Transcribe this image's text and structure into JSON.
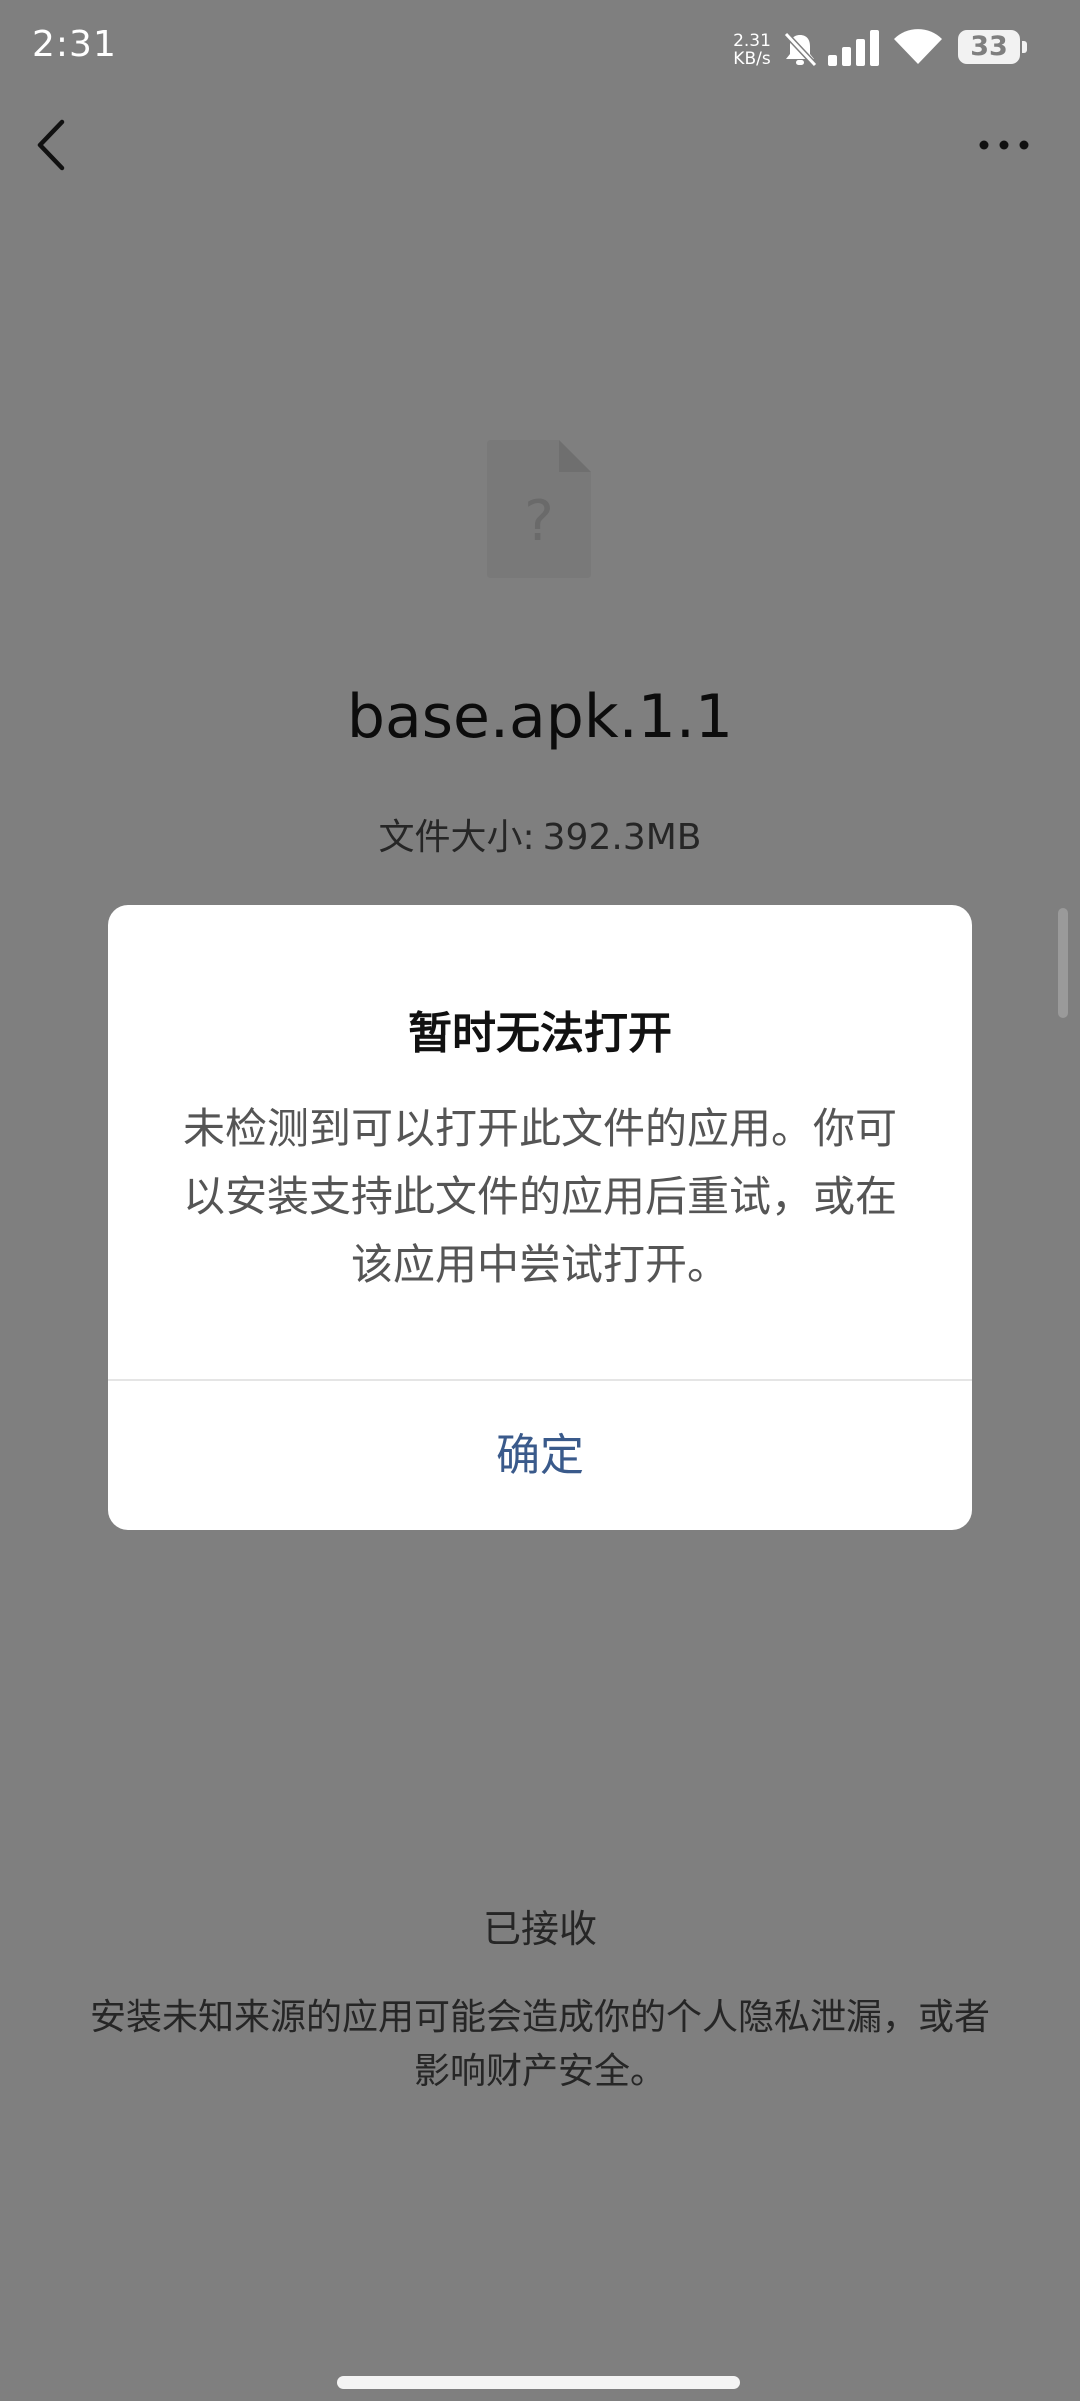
{
  "status_bar": {
    "time": "2:31",
    "network_speed_value": "2.31",
    "network_speed_unit": "KB/s",
    "battery_level": "33",
    "icons": [
      "bell-off-icon",
      "signal-icon",
      "wifi-icon",
      "battery-icon"
    ]
  },
  "toolbar": {
    "back_icon": "chevron-left-icon",
    "more_icon": "more-dots-icon"
  },
  "file": {
    "icon": "unknown-file-icon",
    "icon_glyph": "?",
    "name": "base.apk.1.1",
    "size_label": "文件大小:",
    "size_value": "392.3MB"
  },
  "dialog": {
    "title": "暂时无法打开",
    "message": "未检测到可以打开此文件的应用。你可以安装支持此文件的应用后重试，或在该应用中尝试打开。",
    "confirm_label": "确定"
  },
  "footer": {
    "received_label": "已接收",
    "warning": "安装未知来源的应用可能会造成你的个人隐私泄漏，或者影响财产安全。"
  },
  "colors": {
    "scrim_background": "#7f7f7f",
    "dialog_background": "#ffffff",
    "confirm_text": "#3a5a8b"
  }
}
